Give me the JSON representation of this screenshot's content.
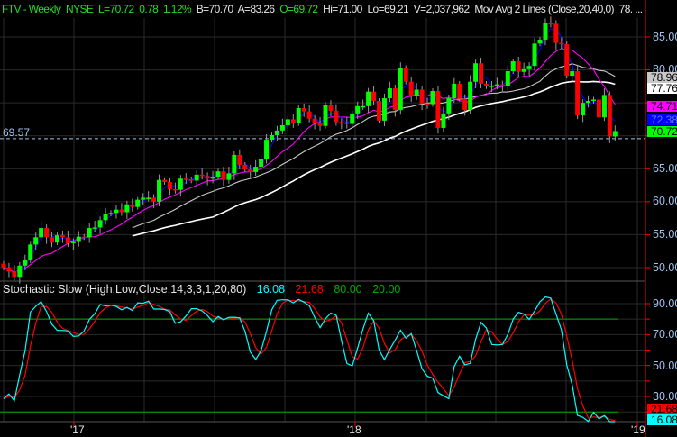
{
  "header": {
    "symbol": "FTV - Weekly",
    "exchange": "NYSE",
    "last": "L=70.72",
    "change": "0.78",
    "change_pct": "1.12%",
    "bid": "B=70.70",
    "ask": "A=83.26",
    "open": "O=69.72",
    "high": "Hi=71.00",
    "low": "Lo=69.21",
    "volume": "V=2,037,962",
    "study": "Mov Avg 2 Lines (Close,20,40,0)",
    "study_value": "78. ..."
  },
  "stoch_header": {
    "title": "Stochastic Slow (High,Low,Close,14,3,3,1,20,80)",
    "k": "16.08",
    "d": "21.68",
    "upper": "80.00",
    "lower": "20.00"
  },
  "reference_line_label": "69.57",
  "price_axis": [
    "85.00",
    "80.00",
    "65.00",
    "60.00",
    "55.00",
    "50.00"
  ],
  "stoch_axis": [
    "90.00",
    "70.00",
    "50.00",
    "30.00"
  ],
  "badges": {
    "ma_gray": "78.96",
    "ma_white": "77.76",
    "ma_magenta": "74.71",
    "ma_blue": "72.38",
    "last": "70.72",
    "stoch_d": "21.68",
    "stoch_k": "16.08"
  },
  "x_labels": [
    "'17",
    "'18",
    "'19"
  ],
  "colors": {
    "up": "#00ff00",
    "down": "#ff0000",
    "magenta": "#ff00ff",
    "blue": "#0000ff",
    "gray": "#c8c8c8",
    "white": "#ffffff",
    "cyan": "#00ffff",
    "grid": "#2a2a2a",
    "axis": "#ff0000"
  },
  "chart_data": {
    "type": "candlestick",
    "interval": "weekly",
    "price_range": [
      48,
      88
    ],
    "reference_price": 69.57,
    "closes": [
      50.0,
      49.4,
      48.6,
      50.3,
      51.1,
      53.5,
      54.6,
      56.0,
      54.6,
      53.8,
      54.9,
      54.6,
      53.7,
      53.9,
      54.7,
      54.6,
      56.0,
      56.1,
      57.2,
      58.2,
      58.3,
      58.8,
      58.4,
      59.6,
      59.2,
      60.3,
      60.6,
      60.6,
      60.0,
      63.3,
      63.0,
      61.9,
      61.8,
      63.5,
      63.4,
      63.2,
      64.1,
      63.9,
      63.5,
      63.8,
      64.6,
      63.3,
      64.3,
      67.1,
      65.6,
      64.9,
      64.5,
      65.3,
      66.5,
      69.4,
      70.1,
      70.8,
      71.6,
      72.5,
      71.9,
      74.2,
      73.7,
      72.6,
      72.0,
      71.5,
      74.7,
      73.8,
      72.1,
      72.0,
      71.8,
      73.4,
      74.5,
      74.5,
      76.7,
      75.3,
      72.3,
      75.7,
      77.2,
      73.9,
      80.3,
      78.2,
      76.0,
      77.0,
      74.9,
      74.8,
      76.8,
      71.2,
      73.4,
      75.7,
      77.9,
      75.6,
      73.9,
      78.2,
      81.0,
      77.9,
      77.5,
      77.6,
      77.8,
      77.6,
      79.8,
      81.3,
      79.7,
      80.1,
      80.6,
      84.0,
      84.6,
      87.1,
      87.0,
      84.1,
      83.9,
      79.1,
      79.8,
      73.1,
      75.0,
      75.3,
      75.5,
      72.8,
      76.2,
      69.9,
      70.72
    ],
    "first_open": 50.6,
    "moving_averages": [
      {
        "name": "fast",
        "period": 3,
        "color": "#0000ff"
      },
      {
        "name": "mid",
        "period": 10,
        "color": "#ff00ff"
      },
      {
        "name": "ma20",
        "period": 20,
        "color": "#c8c8c8"
      },
      {
        "name": "ma40",
        "period": 40,
        "color": "#ffffff"
      }
    ],
    "stochastic": {
      "k_period": 14,
      "slowing": 3,
      "d_period": 3,
      "upper": 80,
      "lower": 20,
      "range": [
        0,
        100
      ]
    },
    "x_tick_labels": [
      "'17",
      "'18",
      "'19"
    ]
  }
}
